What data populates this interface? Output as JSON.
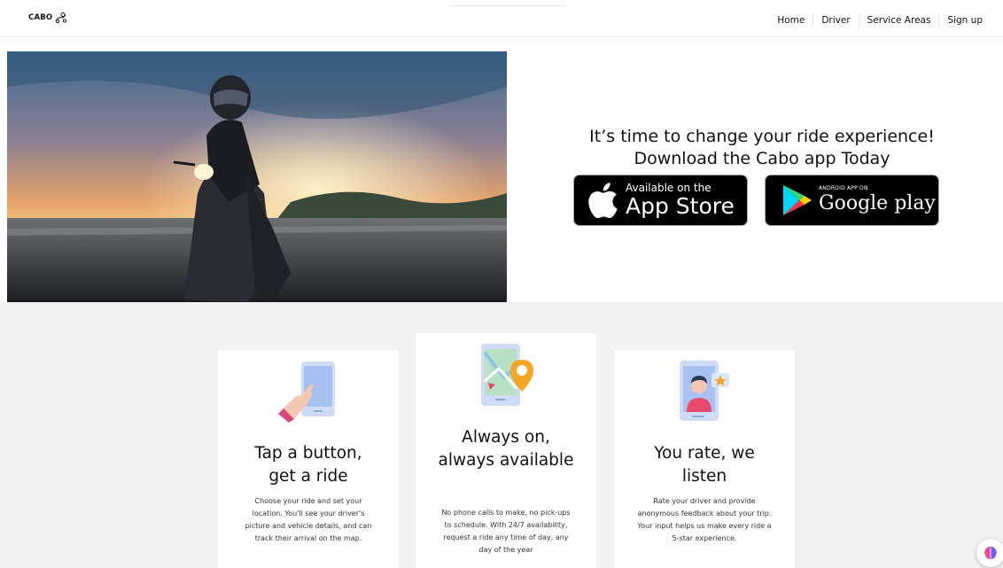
{
  "header": {
    "logo_text": "CABO",
    "nav": [
      "Home",
      "Driver",
      "Service Areas",
      "Sign up"
    ]
  },
  "hero": {
    "headline_line1": "It’s time to change your ride experience!",
    "headline_line2": "Download the Cabo app Today",
    "app_store": {
      "small": "Available on the",
      "big": "App Store"
    },
    "google_play": {
      "small": "ANDROID APP ON",
      "big": "Google play"
    }
  },
  "features": [
    {
      "title_line1": "Tap a button,",
      "title_line2": "get a ride",
      "desc": [
        "Choose your ride and set your",
        "location. You'll see your driver's",
        "picture and vehicle details, and can",
        "track their arrival on the map."
      ],
      "icon": "phone-tap-icon"
    },
    {
      "title_line1": "Always on,",
      "title_line2": "always available",
      "desc": [
        "No phone calls to make, no pick-ups",
        "to schedule. With 24/7 availability,",
        "request a ride any time of day, any",
        "day of the year"
      ],
      "icon": "map-location-icon"
    },
    {
      "title_line1": "You rate, we",
      "title_line2": "listen",
      "desc": [
        "Rate your driver and provide",
        "anonymous feedback about your trip.",
        "Your input helps us make every ride a",
        "5-star experience."
      ],
      "icon": "driver-rating-icon"
    }
  ],
  "colors": {
    "section_bg": "#f2f2f2",
    "badge_bg": "#000000",
    "accent_orange": "#f5a623"
  }
}
